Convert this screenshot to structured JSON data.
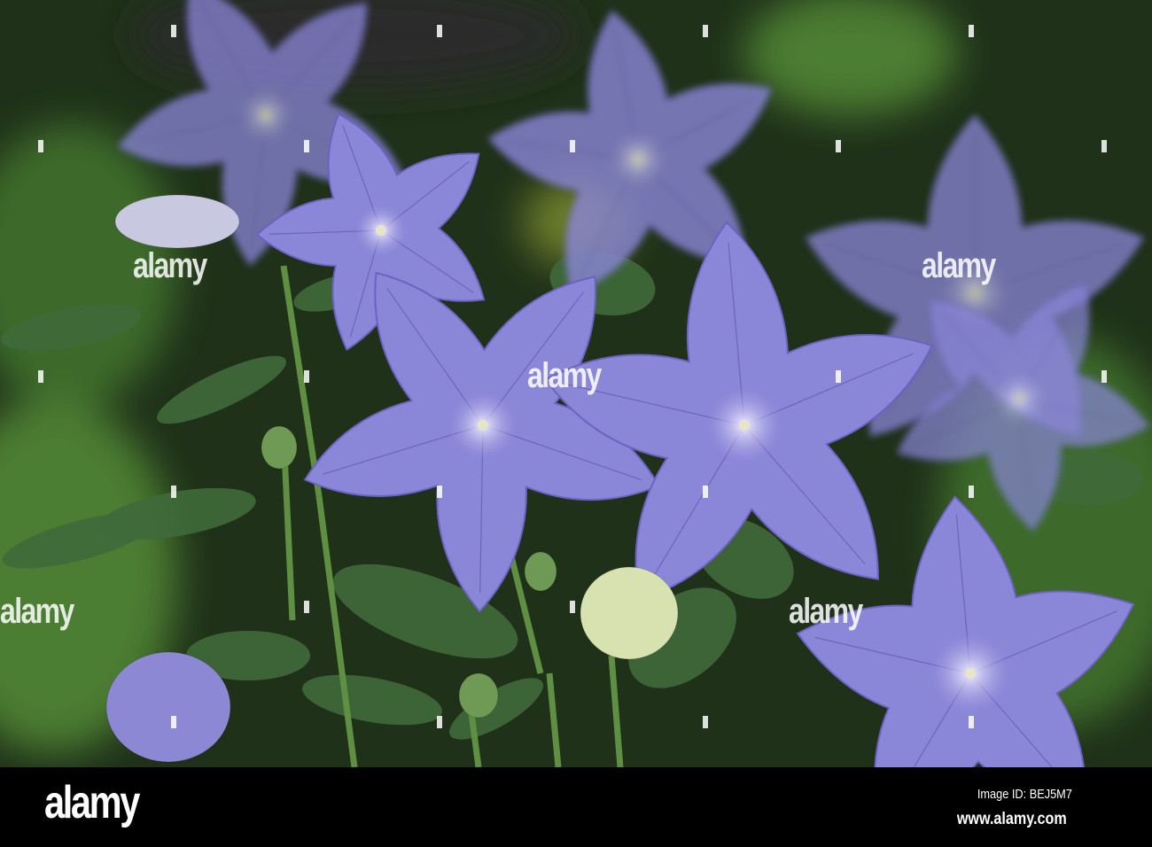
{
  "photo": {
    "subject": "balloon flowers",
    "colors": {
      "petal": "#8a86d8",
      "petal_dark": "#6b62c2",
      "leaf": "#3f6a3a",
      "background": "#24381f",
      "vein": "#5a4fae"
    }
  },
  "watermark": {
    "text": "alamy"
  },
  "footer": {
    "logo": "alamy",
    "image_id": "Image ID: BEJ5M7",
    "website": "www.alamy.com"
  }
}
